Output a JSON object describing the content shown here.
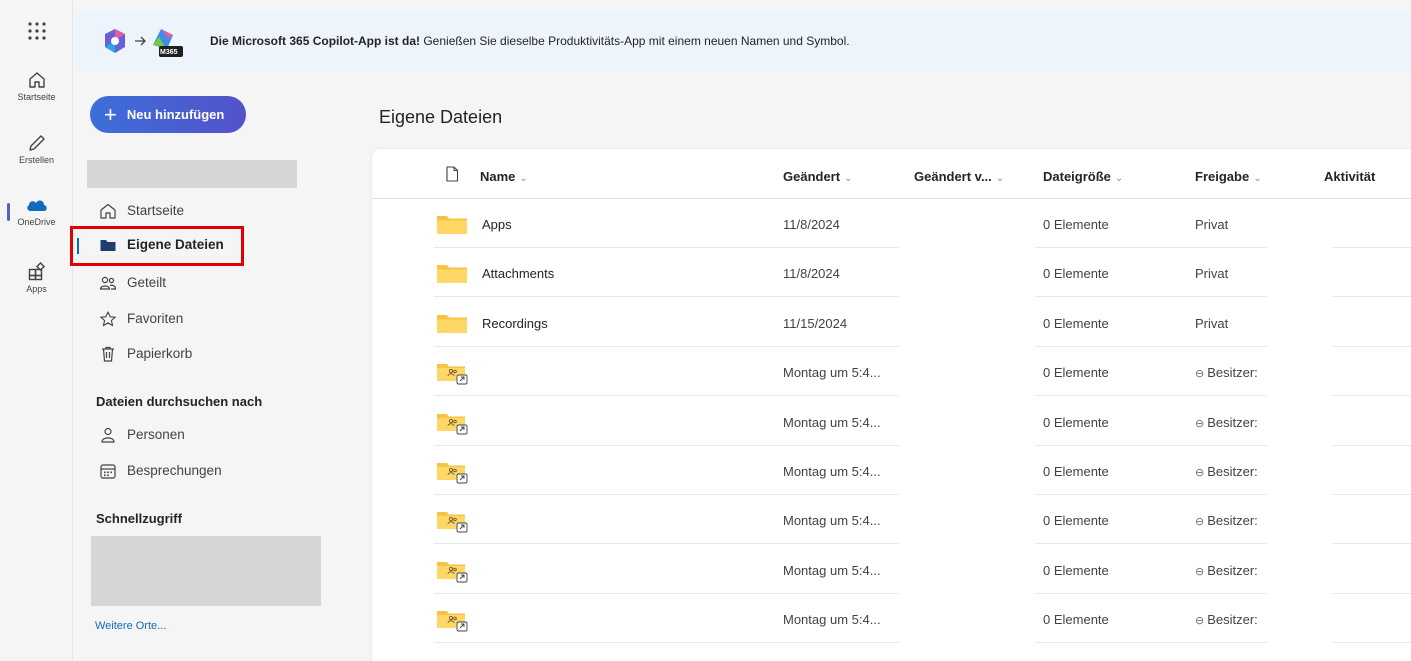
{
  "rail": {
    "items": [
      {
        "label": "Startseite"
      },
      {
        "label": "Erstellen"
      },
      {
        "label": "OneDrive"
      },
      {
        "label": "Apps"
      }
    ]
  },
  "banner": {
    "badge": "M365",
    "title": "Die Microsoft 365 Copilot-App ist da!",
    "text": " Genießen Sie dieselbe Produktivitäts-App mit einem neuen Namen und Symbol."
  },
  "sidebar": {
    "new_button": "Neu hinzufügen",
    "nav": [
      {
        "label": "Startseite"
      },
      {
        "label": "Eigene Dateien"
      },
      {
        "label": "Geteilt"
      },
      {
        "label": "Favoriten"
      },
      {
        "label": "Papierkorb"
      }
    ],
    "browse_heading": "Dateien durchsuchen nach",
    "browse": [
      {
        "label": "Personen"
      },
      {
        "label": "Besprechungen"
      }
    ],
    "quick_heading": "Schnellzugriff",
    "more_link": "Weitere Orte..."
  },
  "main": {
    "title": "Eigene Dateien",
    "columns": {
      "name": "Name",
      "modified": "Geändert",
      "modified_by": "Geändert v...",
      "size": "Dateigröße",
      "sharing": "Freigabe",
      "activity": "Aktivität"
    },
    "rows": [
      {
        "name": "Apps",
        "modified": "11/8/2024",
        "size": "0 Elemente",
        "sharing": "Privat",
        "shared": false
      },
      {
        "name": "Attachments",
        "modified": "11/8/2024",
        "size": "0 Elemente",
        "sharing": "Privat",
        "shared": false
      },
      {
        "name": "Recordings",
        "modified": "11/15/2024",
        "size": "0 Elemente",
        "sharing": "Privat",
        "shared": false
      },
      {
        "name": "",
        "modified": "Montag um 5:4...",
        "size": "0 Elemente",
        "sharing": "Besitzer:",
        "shared": true
      },
      {
        "name": "",
        "modified": "Montag um 5:4...",
        "size": "0 Elemente",
        "sharing": "Besitzer:",
        "shared": true
      },
      {
        "name": "",
        "modified": "Montag um 5:4...",
        "size": "0 Elemente",
        "sharing": "Besitzer:",
        "shared": true
      },
      {
        "name": "",
        "modified": "Montag um 5:4...",
        "size": "0 Elemente",
        "sharing": "Besitzer:",
        "shared": true
      },
      {
        "name": "",
        "modified": "Montag um 5:4...",
        "size": "0 Elemente",
        "sharing": "Besitzer:",
        "shared": true
      },
      {
        "name": "",
        "modified": "Montag um 5:4...",
        "size": "0 Elemente",
        "sharing": "Besitzer:",
        "shared": true
      }
    ]
  },
  "colors": {
    "accent": "#5b5fc7",
    "link": "#0f6cbd",
    "highlight": "#e00000",
    "folder": "#f6c342"
  }
}
